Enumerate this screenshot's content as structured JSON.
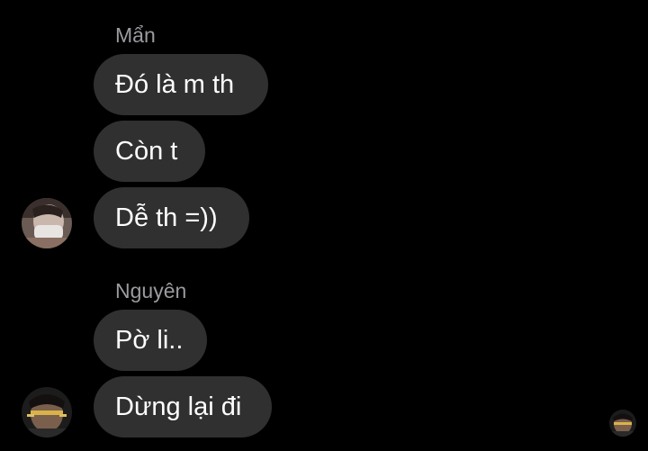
{
  "groups": [
    {
      "sender": "Mẩn",
      "messages": [
        {
          "text": "Đó là m th"
        },
        {
          "text": "Còn t"
        },
        {
          "text": "Dễ th =))"
        }
      ]
    },
    {
      "sender": "Nguyên",
      "messages": [
        {
          "text": "Pờ li.."
        },
        {
          "text": "Dừng lại đi"
        }
      ]
    }
  ],
  "colors": {
    "background": "#000000",
    "bubble": "#303030",
    "sender_name": "#9a9aa0",
    "message_text": "#ffffff"
  },
  "icons": [
    "avatar-photo-man",
    "avatar-photo-nguyen",
    "read-receipt-avatar"
  ]
}
